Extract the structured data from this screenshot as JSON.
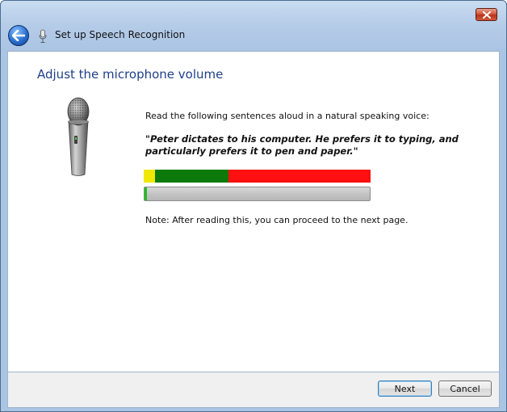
{
  "window": {
    "title": "Set up Speech Recognition"
  },
  "page": {
    "heading": "Adjust the microphone volume",
    "instruction": "Read the following sentences aloud in a natural speaking voice:",
    "quote": "\"Peter dictates to his computer. He prefers it to typing, and particularly prefers it to pen and paper.\"",
    "note": "Note: After reading this, you can proceed to the next page.",
    "progress_fraction": 0.01
  },
  "buttons": {
    "next": "Next",
    "cancel": "Cancel"
  },
  "colors": {
    "heading": "#1e3f8a",
    "meter_low": "#f0e800",
    "meter_ok": "#0b7a0b",
    "meter_high": "#ff1010"
  },
  "icons": {
    "back": "back-arrow-icon",
    "close": "close-icon",
    "title_mic": "microphone-icon",
    "large_mic": "microphone-icon"
  }
}
